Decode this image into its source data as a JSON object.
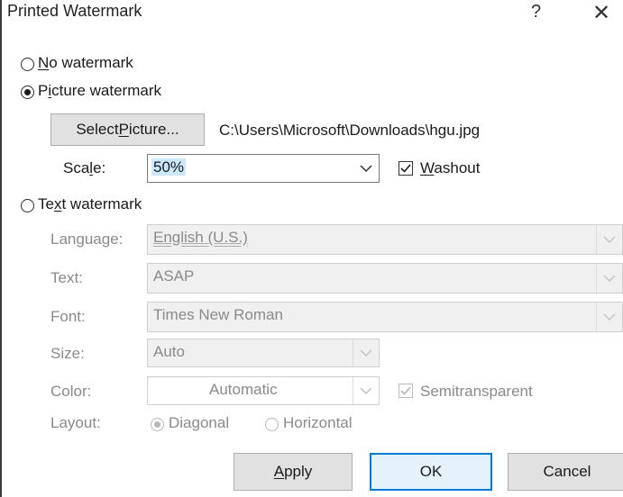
{
  "dialog": {
    "title": "Printed Watermark",
    "help_label": "?",
    "close_label": "✕"
  },
  "options": {
    "no_watermark": {
      "pre": "",
      "key": "N",
      "post": "o watermark",
      "checked": false
    },
    "picture_watermark": {
      "pre": "P",
      "key": "i",
      "post": "cture watermark",
      "checked": true
    },
    "text_watermark": {
      "pre": "Te",
      "key": "x",
      "post": "t watermark",
      "checked": false
    }
  },
  "picture": {
    "select_button": {
      "pre": "Select ",
      "key": "P",
      "post": "icture..."
    },
    "file_path": "C:\\Users\\Microsoft\\Downloads\\hgu.jpg",
    "scale_label": {
      "pre": "Sca",
      "key": "l",
      "post": "e:"
    },
    "scale_value": "50%",
    "washout": {
      "key": "W",
      "post": "ashout",
      "checked": true
    }
  },
  "text": {
    "language_label": "Language:",
    "language_value": "English (U.S.)",
    "text_label": "Text:",
    "text_value": "ASAP",
    "font_label": "Font:",
    "font_value": "Times New Roman",
    "size_label": "Size:",
    "size_value": "Auto",
    "color_label": "Color:",
    "color_value": "Automatic",
    "semitransparent_label": "Semitransparent",
    "semitransparent_checked": true,
    "layout_label": "Layout:",
    "diagonal_label": "Diagonal",
    "diagonal_checked": true,
    "horizontal_label": "Horizontal",
    "horizontal_checked": false
  },
  "buttons": {
    "apply": {
      "key": "A",
      "post": "pply"
    },
    "ok": "OK",
    "cancel": "Cancel"
  },
  "colors": {
    "accent": "#0078d7",
    "selection": "#cce8ff",
    "disabled_text": "#8a8a8a"
  }
}
